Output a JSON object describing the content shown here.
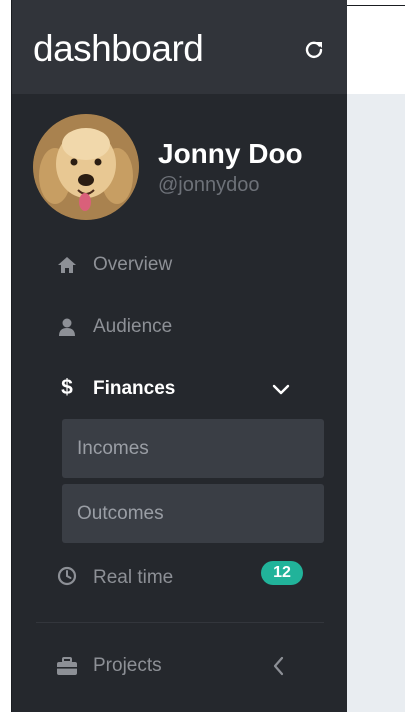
{
  "app": {
    "title": "dashboard"
  },
  "user": {
    "name": "Jonny Doo",
    "handle": "@jonnydoo"
  },
  "nav": {
    "overview": "Overview",
    "audience": "Audience",
    "finances": "Finances",
    "finances_sub": [
      "Incomes",
      "Outcomes"
    ],
    "realtime": "Real time",
    "realtime_badge": "12",
    "projects": "Projects"
  },
  "icons": {
    "refresh": "refresh-icon",
    "overview": "home-icon",
    "audience": "user-icon",
    "finances": "dollar-icon",
    "finances_toggle": "chevron-down-icon",
    "realtime": "clock-icon",
    "projects": "briefcase-icon",
    "projects_toggle": "chevron-left-icon"
  },
  "colors": {
    "sidebar": "#25282d",
    "header": "#31343a",
    "badge": "#21b39a",
    "content": "#e9edf1"
  }
}
